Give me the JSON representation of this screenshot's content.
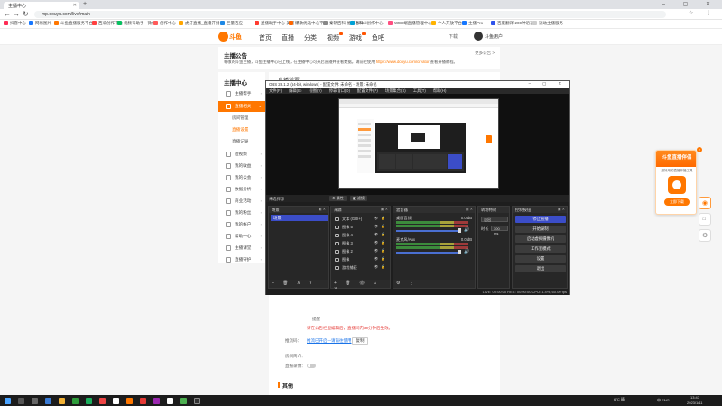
{
  "browser": {
    "tab_title": "主播中心",
    "url": "mp.douyu.com/live/main",
    "new_tab_glyph": "+",
    "window_buttons": "–  ▢  ✕",
    "url_icons": "☆  ⋮",
    "bookmarks": [
      {
        "label": "抖音中心",
        "color": "#fe2c55"
      },
      {
        "label": "网易图片",
        "color": "#1677ff"
      },
      {
        "label": "斗鱼直播服务平台",
        "color": "#ff7700"
      },
      {
        "label": "西瓜创作平台",
        "color": "#ff4040"
      },
      {
        "label": "视频号助手 · 微信",
        "color": "#07c160"
      },
      {
        "label": "创作中心",
        "color": "#ff5a5a"
      },
      {
        "label": "虎牙直播_直播开播",
        "color": "#ffa500"
      },
      {
        "label": "巨量百应",
        "color": "#1e88e5"
      },
      {
        "label": "直播助手中心-美呀",
        "color": "#ff3b30"
      },
      {
        "label": "爆款优选中心平台",
        "color": "#ff6600"
      },
      {
        "label": "秦朝百科-维基百科",
        "color": "#888888"
      },
      {
        "label": "Bilibili创作中心",
        "color": "#00a1d6"
      },
      {
        "label": "WEB端直播管理中心",
        "color": "#ff4f81"
      },
      {
        "label": "个人开放平台",
        "color": "#ffb300"
      },
      {
        "label": "主播Pro",
        "color": "#1677ff"
      },
      {
        "label": "百度翻译-200种语言",
        "color": "#2f54eb"
      },
      {
        "label": "流动主播服务",
        "color": "#cccccc"
      }
    ]
  },
  "site": {
    "logo_text": "斗鱼",
    "nav": [
      "首页",
      "直播",
      "分类",
      "视频",
      "游戏",
      "鱼吧"
    ],
    "header_right": "下载",
    "username": "斗鱼用户"
  },
  "announcement": {
    "title": "主播公告",
    "link": "更多公告 >",
    "body": "尊敬的斗鱼主播，斗鱼主播中心已上线，在主播中心可开启直播并查看数据。请前往使用",
    "body_link": "https://www.douyu.com/creator",
    "body_tail": "查看开播教程。"
  },
  "sidebar": {
    "title": "主播中心",
    "items": [
      {
        "label": "主播帮手",
        "active": false
      },
      {
        "label": "直播相关",
        "active": true
      }
    ],
    "sub_items": [
      {
        "label": "房间管理",
        "active": false
      },
      {
        "label": "直播设置",
        "active": true
      },
      {
        "label": "直播记录",
        "active": false
      }
    ],
    "more_items": [
      "短视频",
      "我的收益",
      "我的公会",
      "数据分析",
      "商业活动",
      "我的粉丝",
      "我的帐户",
      "帮助中心",
      "主播课堂",
      "直播守护"
    ]
  },
  "content": {
    "crumb": "直播设置",
    "tip_label": "提醒",
    "warning": "请在公告栏里编辑后，直播间内30分钟后生效。",
    "stream_label": "推流码：",
    "stream_link": "推流已开启—请前往使用",
    "copy_button": "复制",
    "desc_label": "房间简介：",
    "record_label": "直播录像：",
    "section_title": "其他"
  },
  "promo": {
    "title": "斗鱼直播伴侣",
    "subtitle": "超好用的直播开播工具",
    "download": "立即下载",
    "close_glyph": "×"
  },
  "obs": {
    "window_title": "OBS 28.1.2 (64-bit, windows) - 配置文件: 未命名 - 场景: 未命名",
    "window_buttons": "–  ▢  ✕",
    "menu": [
      "文件(F)",
      "编辑(E)",
      "视图(V)",
      "停靠窗口(D)",
      "配置文件(P)",
      "场景集合(S)",
      "工具(T)",
      "帮助(H)"
    ],
    "scene_bar_label": "未选择源",
    "scene_bar_buttons": [
      "属性",
      "滤镜"
    ],
    "scenes": {
      "title": "场景",
      "items": [
        "场景"
      ]
    },
    "sources": {
      "title": "来源",
      "items": [
        "文本 (GDI+)",
        "图像 5",
        "图像 4",
        "图像 3",
        "图像 2",
        "图像",
        "游戏捕获"
      ]
    },
    "mixer": {
      "title": "混音器",
      "channels": [
        {
          "name": "桌面音频",
          "db": "0.0 dB"
        },
        {
          "name": "麦克风/Aux",
          "db": "0.0 dB"
        }
      ]
    },
    "transitions": {
      "title": "转场特效",
      "type": "淡出",
      "duration_label": "时长",
      "duration": "300 ms"
    },
    "controls": {
      "title": "控制按钮",
      "buttons": [
        "停止直播",
        "开始录制",
        "启动虚拟摄像机",
        "工作室模式",
        "设置",
        "退出"
      ]
    },
    "status": "LIVE: 00:00:00   REC: 00:00:00   CPU: 1.4%, 60.00 fps"
  },
  "taskbar": {
    "weather": "6°C 晴",
    "tray": "中 ENG",
    "time": "13:47",
    "date": "2023/1/11"
  },
  "colors": {
    "accent": "#ff7700",
    "obs_selected": "#3b4dc8"
  }
}
